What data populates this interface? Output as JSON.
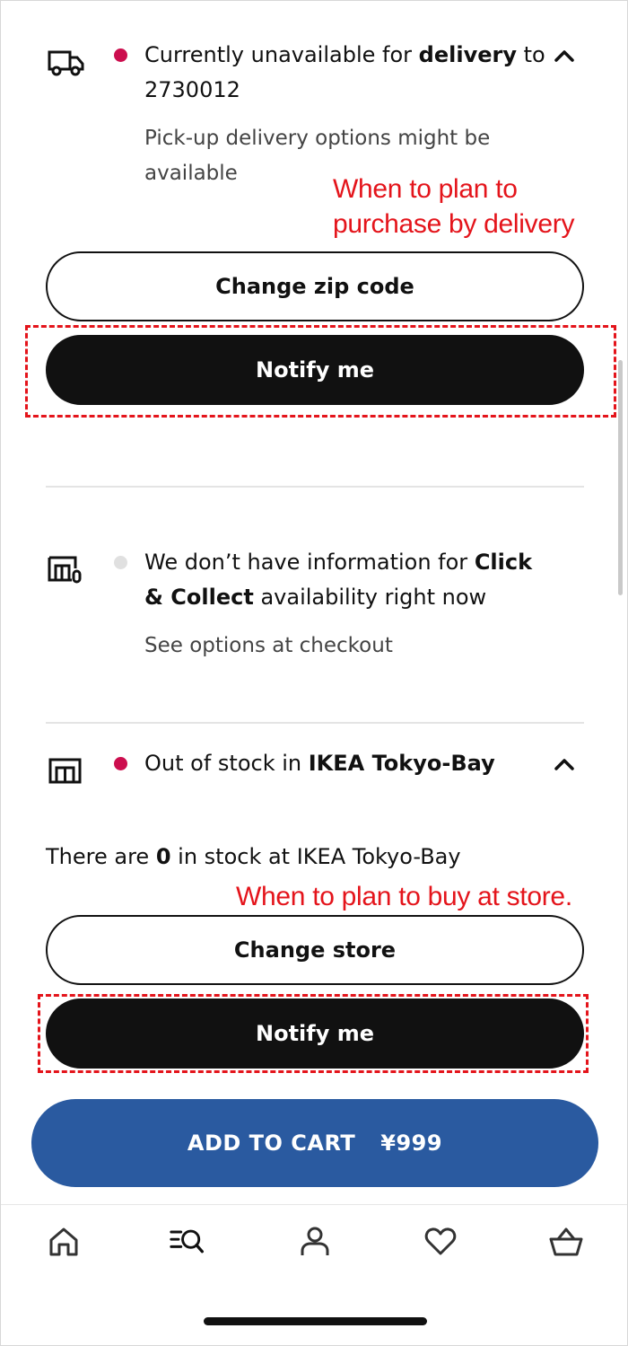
{
  "delivery": {
    "status_prefix": "Currently unavailable for ",
    "status_bold": "delivery",
    "status_suffix": " to",
    "zip": "2730012",
    "hint_line1": "Pick-up delivery options might be",
    "hint_line2": "available",
    "status_color": "#cc0e4e",
    "change_button": "Change zip code",
    "notify_button": "Notify me"
  },
  "click_collect": {
    "line1_prefix": "We don’t have information for ",
    "line1_bold": "Click",
    "line2_bold": "& Collect",
    "line2_suffix": " availability right now",
    "hint": "See options at checkout",
    "status_color": "#e0e0e0"
  },
  "store": {
    "status_prefix": "Out of stock in ",
    "status_bold": "IKEA Tokyo-Bay",
    "status_color": "#cc0e4e",
    "stock_prefix": "There are ",
    "stock_count": "0",
    "stock_suffix": " in stock at IKEA Tokyo-Bay",
    "change_button": "Change store",
    "notify_button": "Notify me"
  },
  "annotations": {
    "delivery_line1": "When to plan to",
    "delivery_line2": "purchase by delivery",
    "store": "When to plan to buy at store.",
    "color": "#e4141b"
  },
  "cart": {
    "label": "ADD TO CART",
    "price": "¥999",
    "color": "#2a5aa0"
  },
  "nav": {
    "items": [
      "home-icon",
      "search-icon",
      "profile-icon",
      "heart-icon",
      "basket-icon"
    ]
  }
}
